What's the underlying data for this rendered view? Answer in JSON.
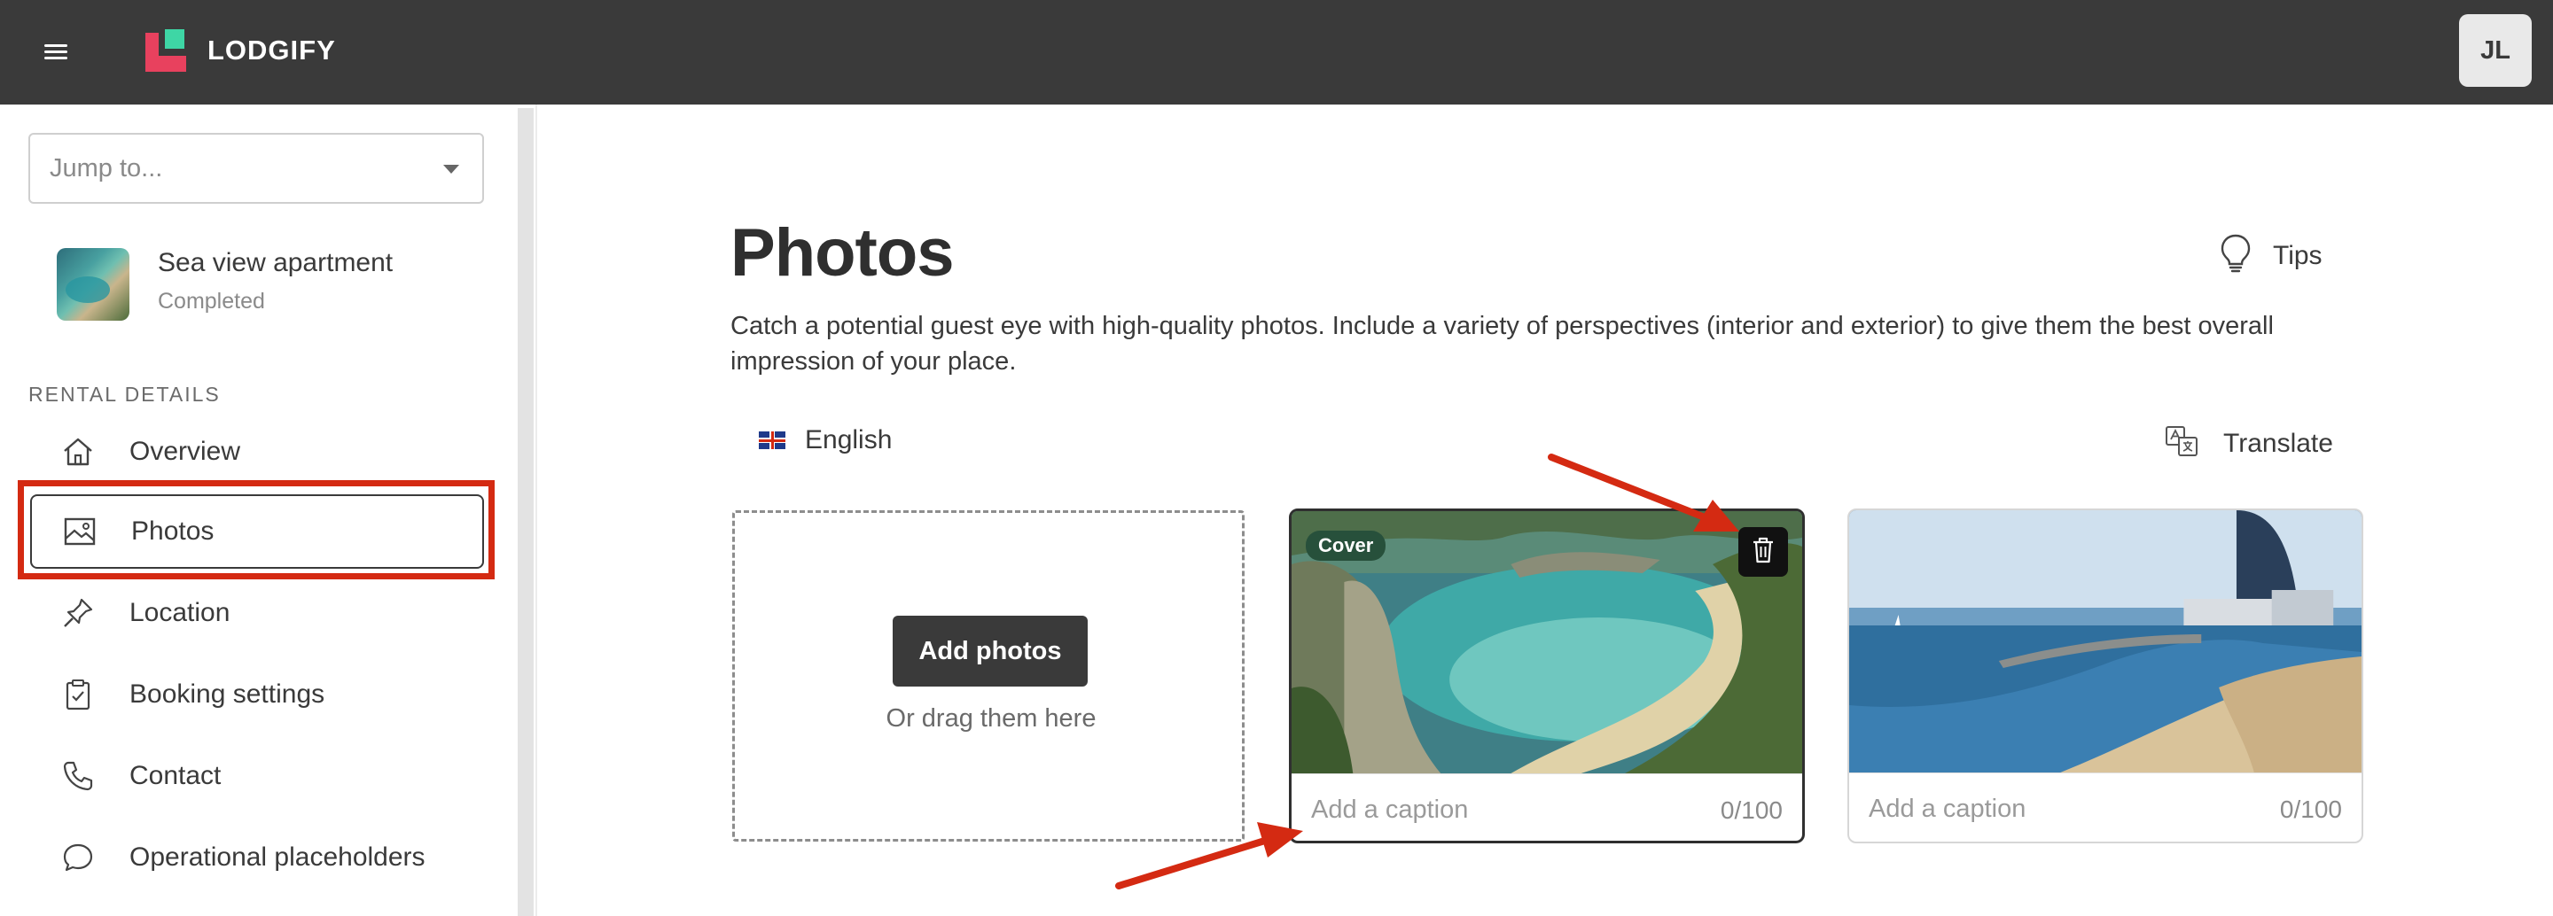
{
  "topbar": {
    "brand": "LODGIFY",
    "user_initials": "JL",
    "menu_icon": "hamburger-menu-icon"
  },
  "sidebar": {
    "jump_placeholder": "Jump to...",
    "property": {
      "name": "Sea view apartment",
      "status": "Completed"
    },
    "section_label": "RENTAL DETAILS",
    "items": [
      {
        "label": "Overview",
        "icon": "home-icon"
      },
      {
        "label": "Photos",
        "icon": "image-icon",
        "active": true
      },
      {
        "label": "Location",
        "icon": "pin-icon"
      },
      {
        "label": "Booking settings",
        "icon": "clipboard-check-icon"
      },
      {
        "label": "Contact",
        "icon": "phone-icon"
      },
      {
        "label": "Operational placeholders",
        "icon": "chat-bubble-icon"
      }
    ]
  },
  "main": {
    "title": "Photos",
    "tips_label": "Tips",
    "description": "Catch a potential guest eye with high-quality photos. Include a variety of perspectives (interior and exterior) to give them the best overall impression of your place.",
    "language": "English",
    "translate_label": "Translate",
    "dropzone": {
      "button_label": "Add photos",
      "hint": "Or drag them here"
    },
    "photos": [
      {
        "cover_label": "Cover",
        "caption_placeholder": "Add a caption",
        "caption_count": "0/100"
      },
      {
        "caption_placeholder": "Add a caption",
        "caption_count": "0/100"
      }
    ]
  },
  "colors": {
    "topbar": "#3a3a3a",
    "brand_pink": "#e8415e",
    "brand_green": "#3ed6a5",
    "highlight": "#d42a12",
    "cover_badge": "#27503b"
  }
}
